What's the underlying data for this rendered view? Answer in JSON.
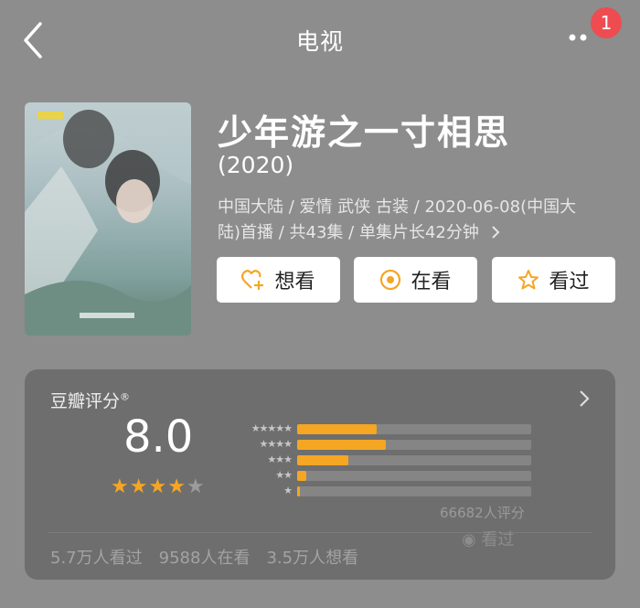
{
  "header": {
    "title": "电视",
    "notification_count": "1"
  },
  "show": {
    "title": "少年游之一寸相思",
    "year": "(2020)",
    "meta_line1": "中国大陆 / 爱情 武侠 古装 / 2020-06-08(中国大",
    "meta_line2": "陆)首播 / 共43集 / 单集片长42分钟"
  },
  "actions": {
    "want": "想看",
    "watching": "在看",
    "watched": "看过"
  },
  "rating": {
    "label": "豆瓣评分",
    "label_mark": "®",
    "score": "8.0",
    "stars": 4,
    "distribution_percent": [
      34,
      38,
      22,
      4,
      1
    ],
    "count": "66682人评分",
    "rate_button": "看过"
  },
  "stats": {
    "watched": "5.7万人看过",
    "watching": "9588人在看",
    "want": "3.5万人想看"
  },
  "colors": {
    "accent": "#f5a623",
    "badge": "#ee4c51"
  }
}
